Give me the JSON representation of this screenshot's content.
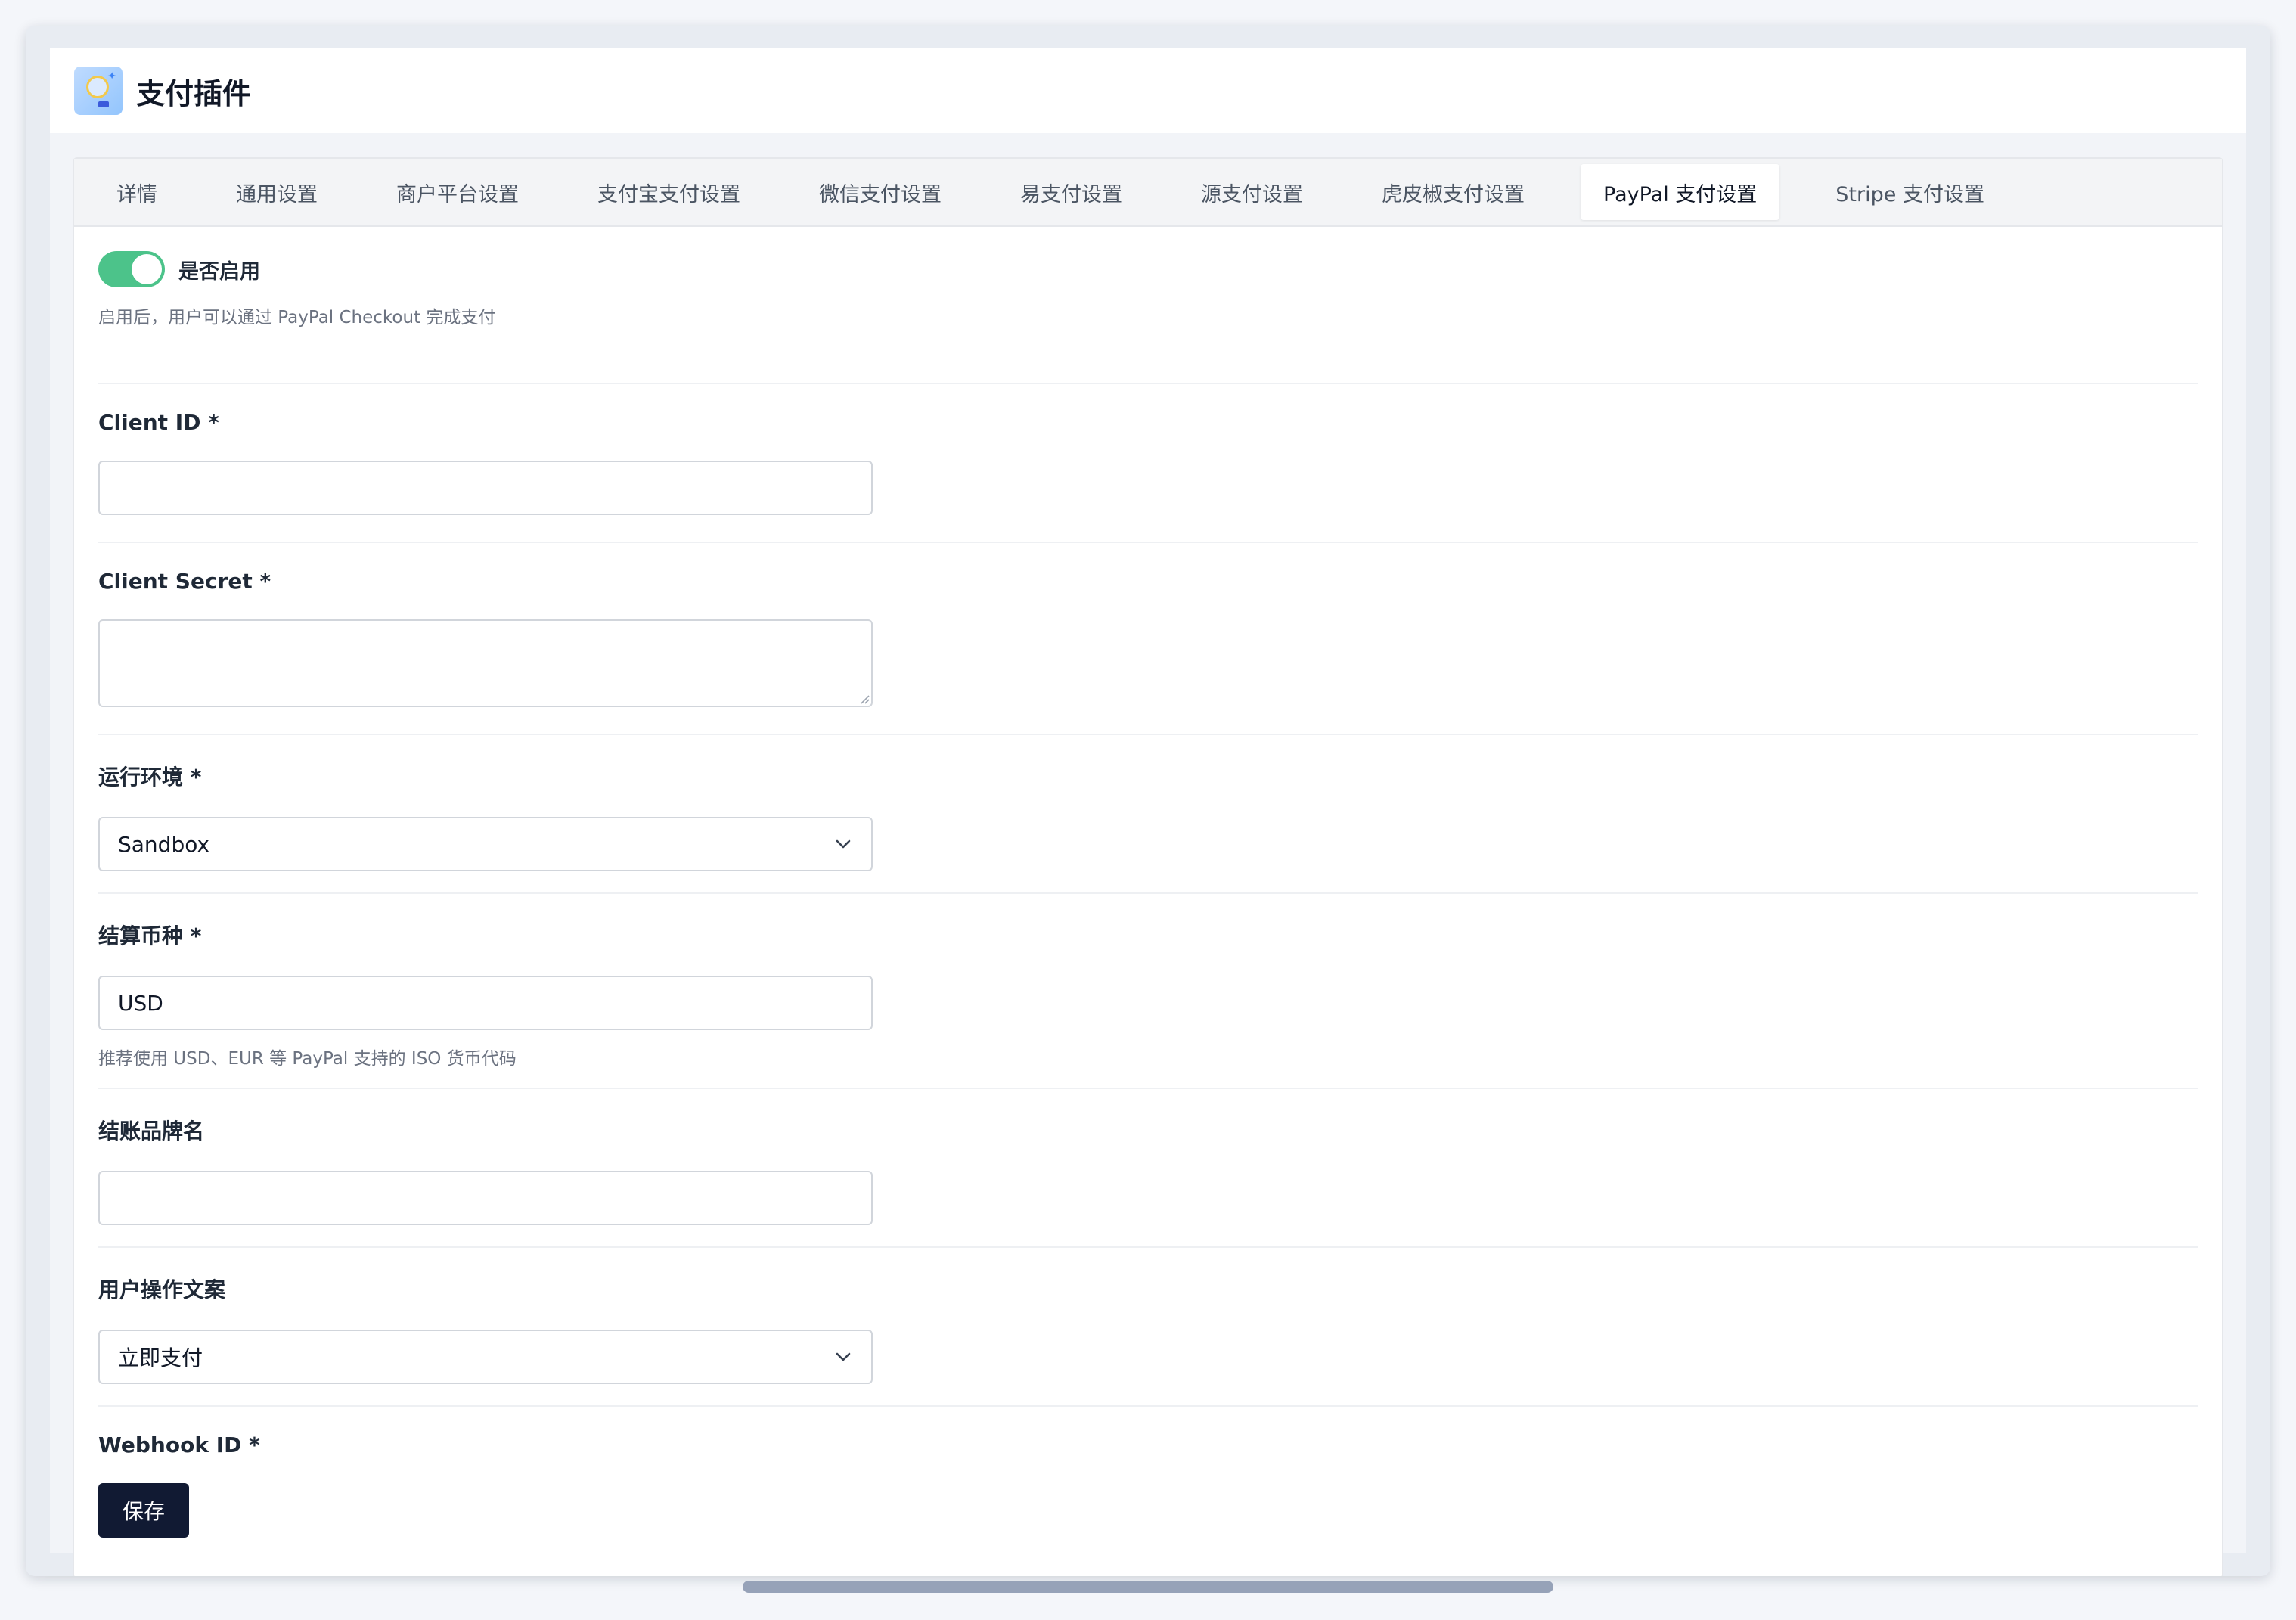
{
  "header": {
    "title": "支付插件",
    "icon": "plugin-lightbulb-icon"
  },
  "tabs": [
    {
      "label": "详情",
      "active": false
    },
    {
      "label": "通用设置",
      "active": false
    },
    {
      "label": "商户平台设置",
      "active": false
    },
    {
      "label": "支付宝支付设置",
      "active": false
    },
    {
      "label": "微信支付设置",
      "active": false
    },
    {
      "label": "易支付设置",
      "active": false
    },
    {
      "label": "源支付设置",
      "active": false
    },
    {
      "label": "虎皮椒支付设置",
      "active": false
    },
    {
      "label": "PayPal 支付设置",
      "active": true
    },
    {
      "label": "Stripe 支付设置",
      "active": false
    }
  ],
  "form": {
    "enabled": {
      "label": "是否启用",
      "value": true,
      "help": "启用后，用户可以通过 PayPal Checkout 完成支付"
    },
    "client_id": {
      "label": "Client ID *",
      "value": "",
      "placeholder": ""
    },
    "client_secret": {
      "label": "Client Secret *",
      "value": ""
    },
    "environment": {
      "label": "运行环境 *",
      "value": "Sandbox"
    },
    "currency": {
      "label": "结算币种 *",
      "value": "USD",
      "help": "推荐使用 USD、EUR 等 PayPal 支持的 ISO 货币代码"
    },
    "brand_name": {
      "label": "结账品牌名",
      "value": ""
    },
    "user_action": {
      "label": "用户操作文案",
      "value": "立即支付"
    },
    "webhook_id": {
      "label": "Webhook ID *"
    },
    "save_label": "保存"
  },
  "colors": {
    "toggle_on": "#4cc38a",
    "save_button": "#111a33",
    "active_tab_bg": "#ffffff"
  }
}
